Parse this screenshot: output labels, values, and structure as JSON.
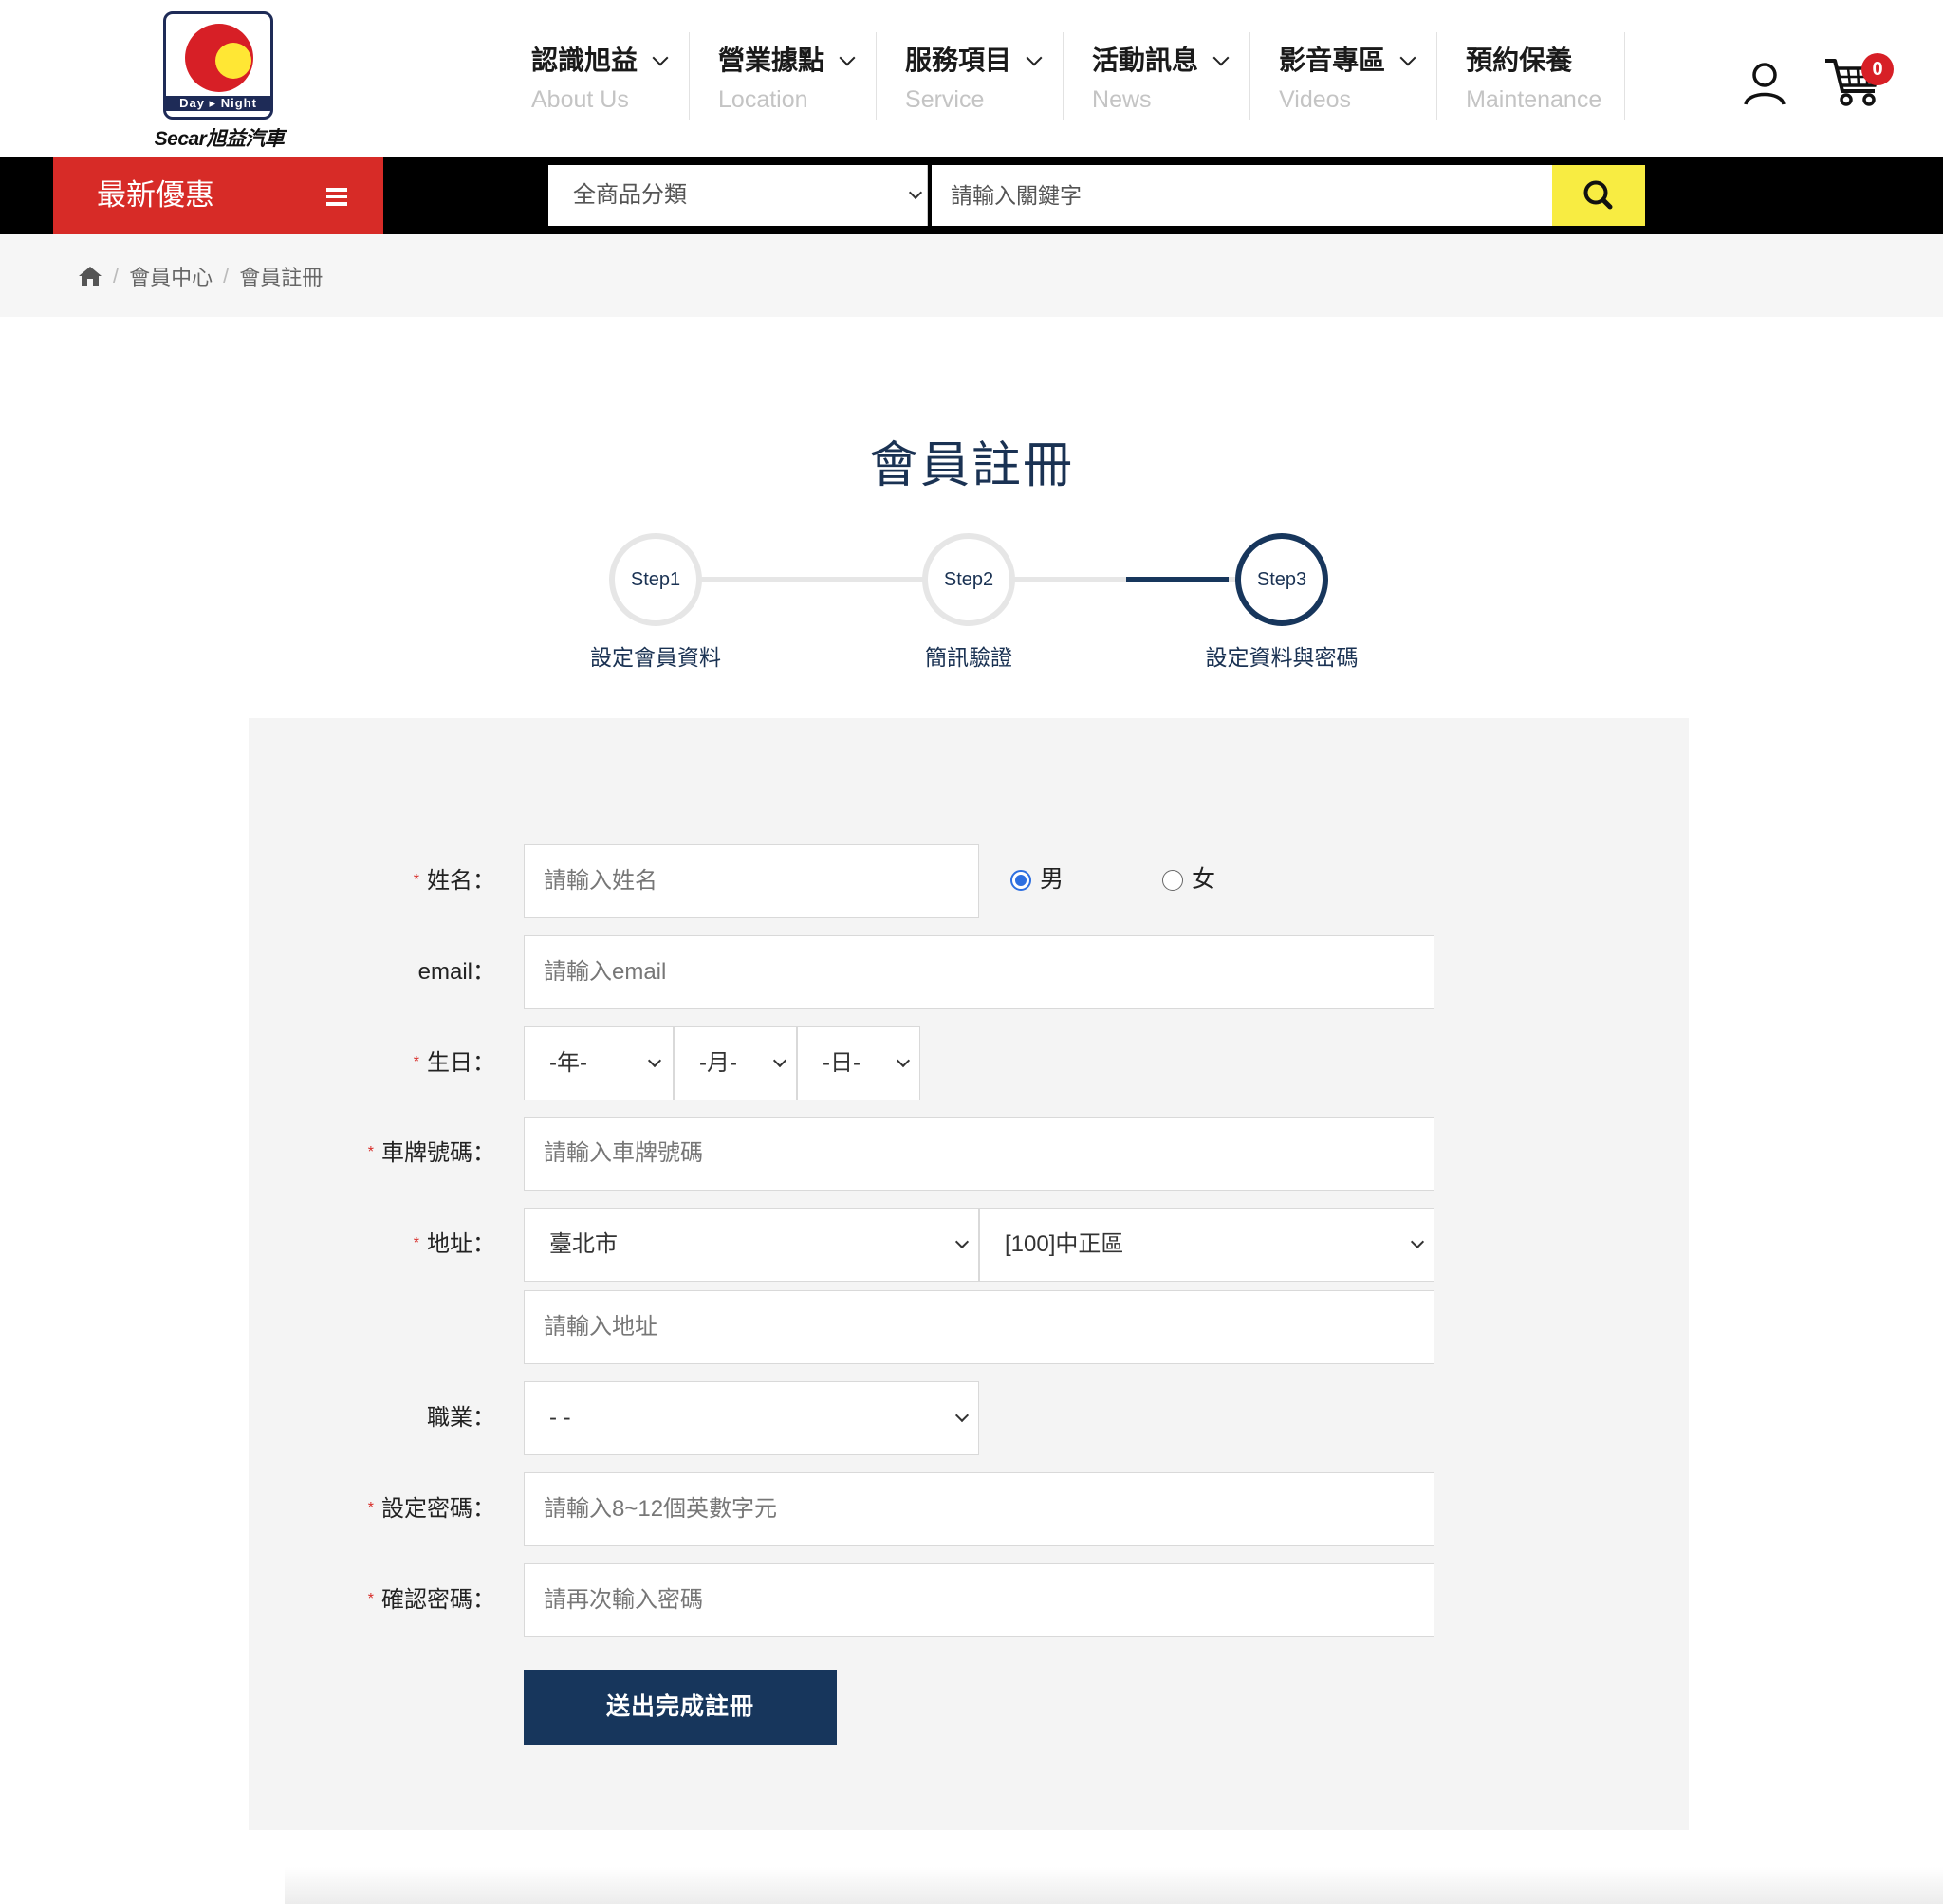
{
  "brand": {
    "logo_band_text": "Day ▸ Night",
    "logo_text": "Secar旭益汽車"
  },
  "nav": [
    {
      "zh": "認識旭益",
      "en": "About Us",
      "has_dropdown": true
    },
    {
      "zh": "營業據點",
      "en": "Location",
      "has_dropdown": true
    },
    {
      "zh": "服務項目",
      "en": "Service",
      "has_dropdown": true
    },
    {
      "zh": "活動訊息",
      "en": "News",
      "has_dropdown": true
    },
    {
      "zh": "影音專區",
      "en": "Videos",
      "has_dropdown": true
    },
    {
      "zh": "預約保養",
      "en": "Maintenance",
      "has_dropdown": false
    }
  ],
  "header_icons": {
    "user": "user-icon",
    "cart": "cart-icon",
    "cart_count": "0"
  },
  "toolbar": {
    "promo_label": "最新優惠",
    "category_select": "全商品分類",
    "search_placeholder": "請輸入關鍵字",
    "search_icon": "search-icon"
  },
  "breadcrumb": {
    "home_icon": "home-icon",
    "items": [
      "會員中心",
      "會員註冊"
    ]
  },
  "page_title": "會員註冊",
  "steps": [
    {
      "circle": "Step1",
      "label": "設定會員資料",
      "active": false
    },
    {
      "circle": "Step2",
      "label": "簡訊驗證",
      "active": false
    },
    {
      "circle": "Step3",
      "label": "設定資料與密碼",
      "active": true
    }
  ],
  "form": {
    "name": {
      "label": "姓名：",
      "placeholder": "請輸入姓名",
      "required": true
    },
    "gender": {
      "options": [
        "男",
        "女"
      ],
      "selected": "男"
    },
    "email": {
      "label": "email：",
      "placeholder": "請輸入email",
      "required": false
    },
    "birthday": {
      "label": "生日：",
      "year": "-年-",
      "month": "-月-",
      "day": "-日-",
      "required": true
    },
    "plate": {
      "label": "車牌號碼：",
      "placeholder": "請輸入車牌號碼",
      "required": true
    },
    "address": {
      "label": "地址：",
      "city": "臺北市",
      "district": "[100]中正區",
      "placeholder": "請輸入地址",
      "required": true
    },
    "job": {
      "label": "職業：",
      "value": "- -",
      "required": false
    },
    "password": {
      "label": "設定密碼：",
      "placeholder": "請輸入8~12個英數字元",
      "required": true
    },
    "confirm": {
      "label": "確認密碼：",
      "placeholder": "請再次輸入密碼",
      "required": true
    },
    "submit_label": "送出完成註冊"
  },
  "colors": {
    "brand_red": "#d72b27",
    "navy": "#17365c",
    "search_yellow": "#f8ec42"
  }
}
